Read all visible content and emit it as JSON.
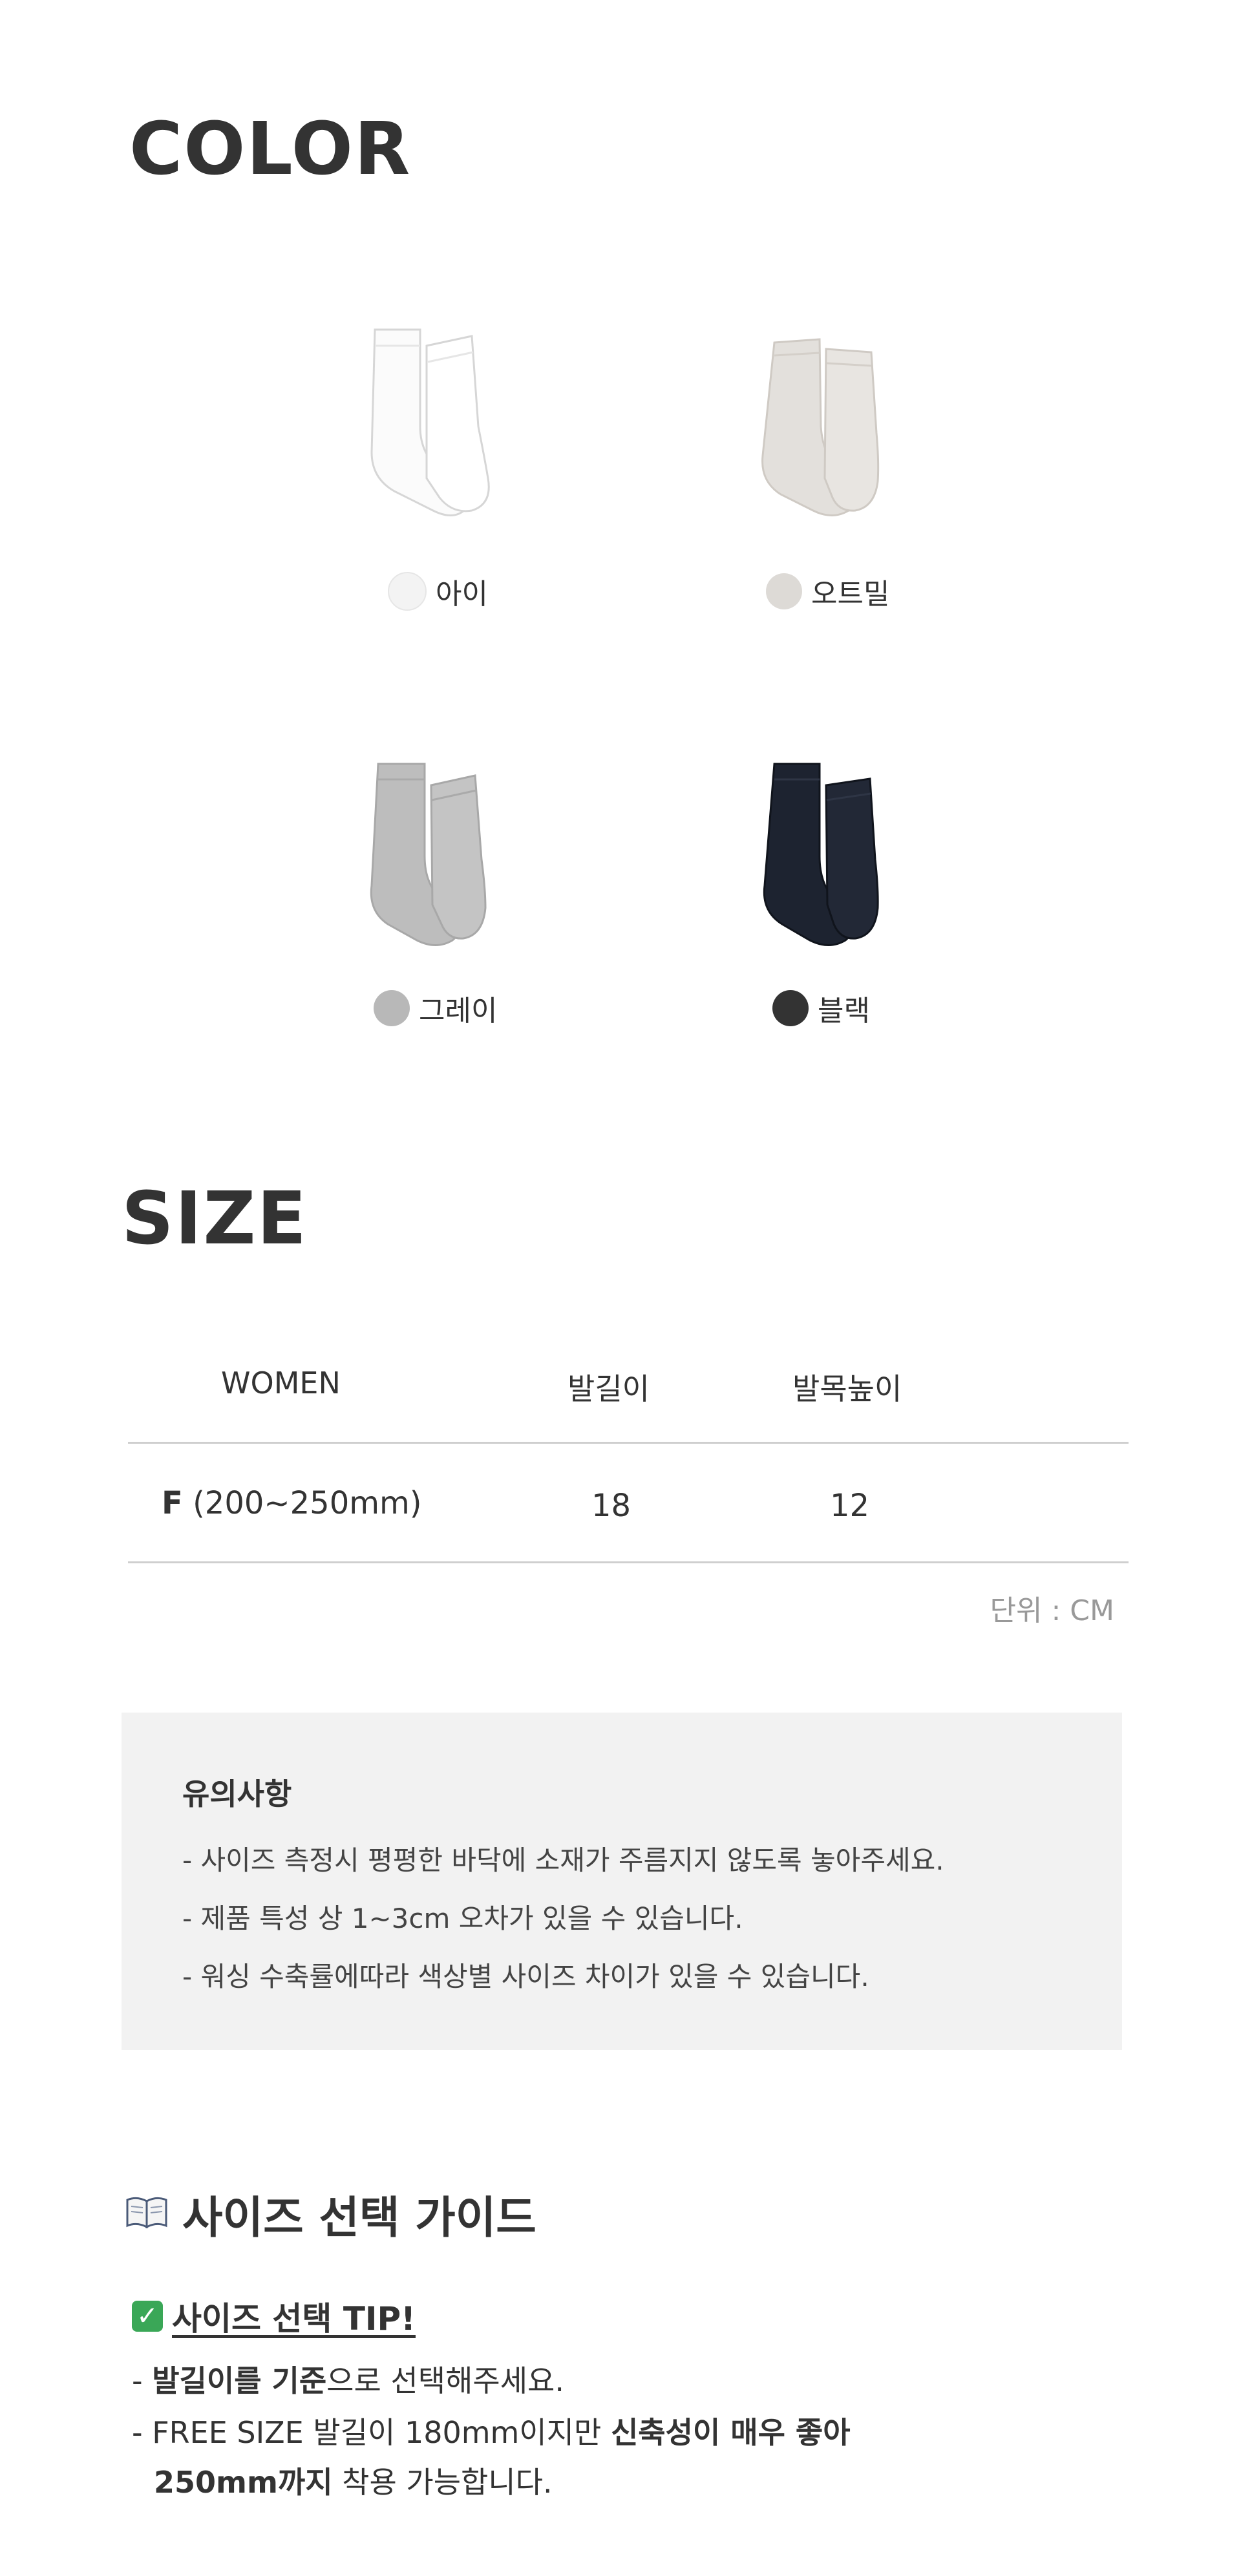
{
  "color_section": {
    "heading": "COLOR",
    "swatches": [
      {
        "label": "아이",
        "color": "#f3f3f3"
      },
      {
        "label": "오트밀",
        "color": "#dddad6"
      },
      {
        "label": "그레이",
        "color": "#b8b8b8"
      },
      {
        "label": "블랙",
        "color": "#333333"
      }
    ]
  },
  "size_section": {
    "heading": "SIZE",
    "table": {
      "headers": [
        "WOMEN",
        "발길이",
        "발목높이"
      ],
      "rows": [
        {
          "size_code": "F",
          "size_range": "(200~250mm)",
          "foot_length": "18",
          "ankle_height": "12"
        }
      ]
    },
    "unit_note": "단위 : CM"
  },
  "notice": {
    "title": "유의사항",
    "lines": [
      "- 사이즈 측정시 평평한 바닥에 소재가 주름지지 않도록 놓아주세요.",
      "- 제품 특성 상 1~3cm 오차가 있을 수 있습니다.",
      "- 워싱 수축률에따라 색상별 사이즈 차이가 있을 수 있습니다."
    ]
  },
  "guide": {
    "title": "사이즈 선택 가이드",
    "title_icon": "open-book-icon",
    "tip_icon": "check-mark-icon",
    "tip_title": "사이즈 선택 TIP!",
    "line1_prefix": "- ",
    "line1_bold": "발길이를 기준",
    "line1_suffix": "으로 선택해주세요.",
    "line2_prefix": "- FREE SIZE 발길이 180mm이지만 ",
    "line2_bold": "신축성이 매우 좋아",
    "line3_bold": "250mm까지",
    "line3_suffix": " 착용 가능합니다."
  }
}
